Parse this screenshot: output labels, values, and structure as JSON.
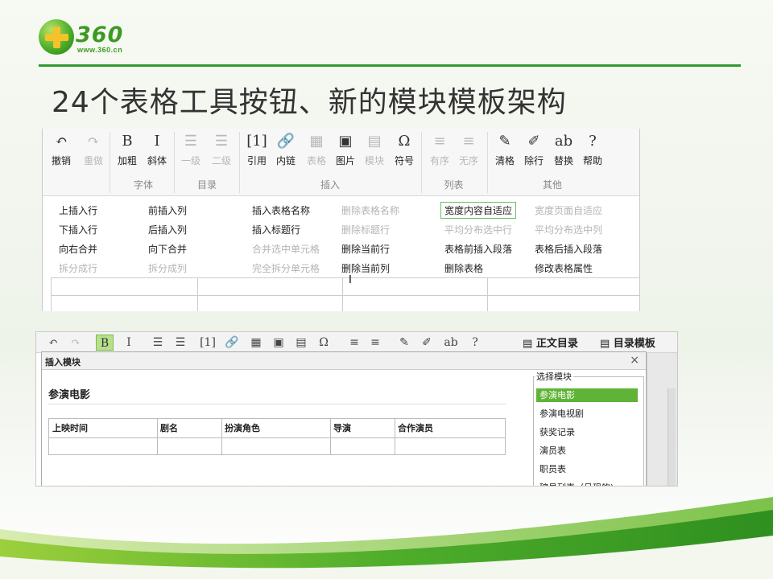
{
  "logo": {
    "text": "360",
    "url": "www.360.cn"
  },
  "slide": {
    "title": "24个表格工具按钮、新的模块模板架构"
  },
  "editor": {
    "buttons": [
      {
        "icon": "undo-icon",
        "glyph": "↶",
        "label": "撤销",
        "enabled": true
      },
      {
        "icon": "redo-icon",
        "glyph": "↷",
        "label": "重做",
        "enabled": false
      },
      {
        "icon": "bold-icon",
        "glyph": "B",
        "label": "加粗",
        "enabled": true
      },
      {
        "icon": "italic-icon",
        "glyph": "I",
        "label": "斜体",
        "enabled": true
      },
      {
        "icon": "heading1-icon",
        "glyph": "☰",
        "label": "一级",
        "enabled": false
      },
      {
        "icon": "heading2-icon",
        "glyph": "☰",
        "label": "二级",
        "enabled": false
      },
      {
        "icon": "quote-icon",
        "glyph": "[1]",
        "label": "引用",
        "enabled": true
      },
      {
        "icon": "link-icon",
        "glyph": "🔗",
        "label": "内链",
        "enabled": true
      },
      {
        "icon": "table-icon",
        "glyph": "▦",
        "label": "表格",
        "enabled": false
      },
      {
        "icon": "image-icon",
        "glyph": "▣",
        "label": "图片",
        "enabled": true
      },
      {
        "icon": "module-icon",
        "glyph": "▤",
        "label": "模块",
        "enabled": false
      },
      {
        "icon": "symbol-icon",
        "glyph": "Ω",
        "label": "符号",
        "enabled": true
      },
      {
        "icon": "ordered-list-icon",
        "glyph": "≡",
        "label": "有序",
        "enabled": false
      },
      {
        "icon": "unordered-list-icon",
        "glyph": "≡",
        "label": "无序",
        "enabled": false
      },
      {
        "icon": "clear-format-icon",
        "glyph": "✎",
        "label": "清格",
        "enabled": true
      },
      {
        "icon": "remove-row-icon",
        "glyph": "✐",
        "label": "除行",
        "enabled": true
      },
      {
        "icon": "replace-icon",
        "glyph": "ab",
        "label": "替换",
        "enabled": true
      },
      {
        "icon": "help-icon",
        "glyph": "?",
        "label": "帮助",
        "enabled": true
      }
    ],
    "groups": [
      "字体",
      "目录",
      "插入",
      "列表",
      "其他"
    ],
    "table_menu": [
      {
        "label": "上插入行",
        "enabled": true
      },
      {
        "label": "前插入列",
        "enabled": true
      },
      {
        "label": "插入表格名称",
        "enabled": true
      },
      {
        "label": "删除表格名称",
        "enabled": false
      },
      {
        "label": "宽度内容自适应",
        "enabled": true
      },
      {
        "label": "宽度页面自适应",
        "enabled": false
      },
      {
        "label": "下插入行",
        "enabled": true
      },
      {
        "label": "后插入列",
        "enabled": true
      },
      {
        "label": "插入标题行",
        "enabled": true
      },
      {
        "label": "删除标题行",
        "enabled": false
      },
      {
        "label": "平均分布选中行",
        "enabled": false
      },
      {
        "label": "平均分布选中列",
        "enabled": false
      },
      {
        "label": "向右合并",
        "enabled": true
      },
      {
        "label": "向下合并",
        "enabled": true
      },
      {
        "label": "合并选中单元格",
        "enabled": false
      },
      {
        "label": "删除当前行",
        "enabled": true
      },
      {
        "label": "表格前插入段落",
        "enabled": true
      },
      {
        "label": "表格后插入段落",
        "enabled": true
      },
      {
        "label": "拆分成行",
        "enabled": false
      },
      {
        "label": "拆分成列",
        "enabled": false
      },
      {
        "label": "完全拆分单元格",
        "enabled": false
      },
      {
        "label": "删除当前列",
        "enabled": true
      },
      {
        "label": "删除表格",
        "enabled": true
      },
      {
        "label": "修改表格属性",
        "enabled": true
      }
    ],
    "cursor": "I"
  },
  "editor2": {
    "side_tabs": [
      "正文目录",
      "目录模板"
    ],
    "dialog": {
      "title": "插入模块",
      "close": "×",
      "heading": "参演电影",
      "columns": [
        "上映时间",
        "剧名",
        "扮演角色",
        "导演",
        "合作演员"
      ],
      "picker_label": "选择模块",
      "templates": [
        "参演电影",
        "参演电视剧",
        "获奖记录",
        "演员表",
        "职员表",
        "殡员列表（呈现的)"
      ],
      "selected_template": "参演电影"
    }
  },
  "colors": {
    "accent": "#2f9a2f",
    "selected": "#5fb336"
  }
}
